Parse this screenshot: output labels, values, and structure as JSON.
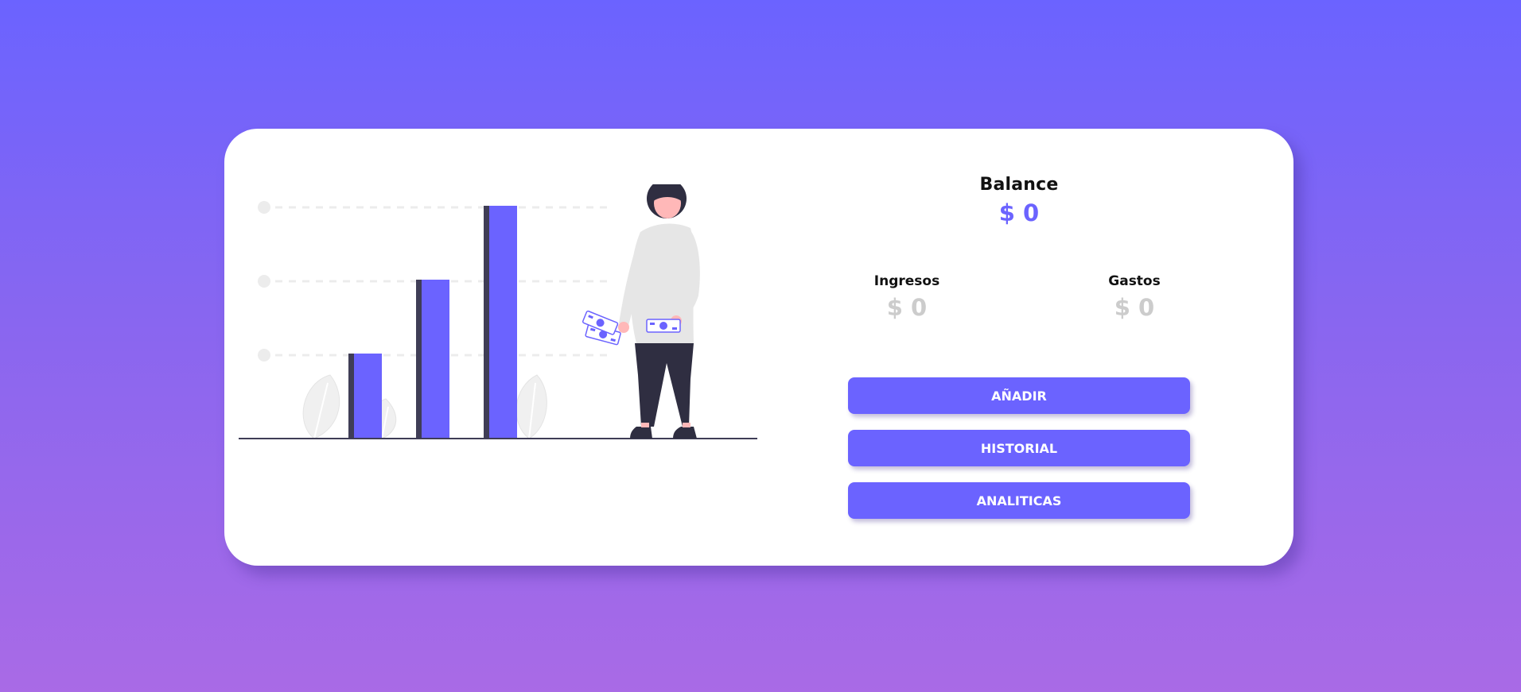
{
  "balance": {
    "title": "Balance",
    "amount": "$ 0"
  },
  "ingresos": {
    "label": "Ingresos",
    "amount": "$ 0"
  },
  "gastos": {
    "label": "Gastos",
    "amount": "$ 0"
  },
  "actions": {
    "add_label": "AÑADIR",
    "history_label": "HISTORIAL",
    "analytics_label": "ANALITICAS"
  },
  "colors": {
    "accent": "#6b63ff",
    "muted": "#cccccc",
    "background_top": "#6b63ff",
    "background_bottom": "#a96ae6"
  },
  "illustration": {
    "name": "woman-with-bar-chart-illustration",
    "icons": [
      "bar-chart-icon",
      "banknote-icon",
      "leaf-icon"
    ]
  }
}
